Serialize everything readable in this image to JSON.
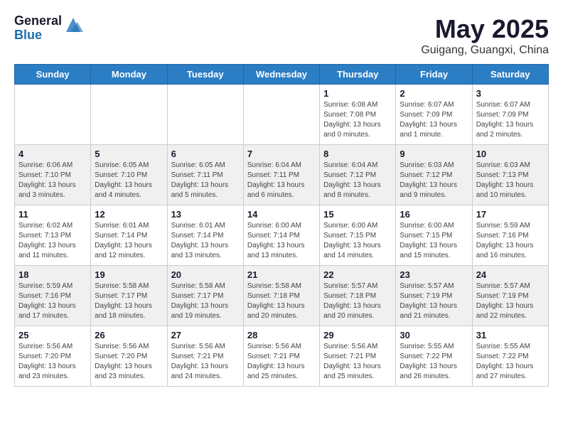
{
  "header": {
    "logo_general": "General",
    "logo_blue": "Blue",
    "title": "May 2025",
    "subtitle": "Guigang, Guangxi, China"
  },
  "days_of_week": [
    "Sunday",
    "Monday",
    "Tuesday",
    "Wednesday",
    "Thursday",
    "Friday",
    "Saturday"
  ],
  "weeks": [
    [
      {
        "day": "",
        "info": ""
      },
      {
        "day": "",
        "info": ""
      },
      {
        "day": "",
        "info": ""
      },
      {
        "day": "",
        "info": ""
      },
      {
        "day": "1",
        "info": "Sunrise: 6:08 AM\nSunset: 7:08 PM\nDaylight: 13 hours and 0 minutes."
      },
      {
        "day": "2",
        "info": "Sunrise: 6:07 AM\nSunset: 7:09 PM\nDaylight: 13 hours and 1 minute."
      },
      {
        "day": "3",
        "info": "Sunrise: 6:07 AM\nSunset: 7:09 PM\nDaylight: 13 hours and 2 minutes."
      }
    ],
    [
      {
        "day": "4",
        "info": "Sunrise: 6:06 AM\nSunset: 7:10 PM\nDaylight: 13 hours and 3 minutes."
      },
      {
        "day": "5",
        "info": "Sunrise: 6:05 AM\nSunset: 7:10 PM\nDaylight: 13 hours and 4 minutes."
      },
      {
        "day": "6",
        "info": "Sunrise: 6:05 AM\nSunset: 7:11 PM\nDaylight: 13 hours and 5 minutes."
      },
      {
        "day": "7",
        "info": "Sunrise: 6:04 AM\nSunset: 7:11 PM\nDaylight: 13 hours and 6 minutes."
      },
      {
        "day": "8",
        "info": "Sunrise: 6:04 AM\nSunset: 7:12 PM\nDaylight: 13 hours and 8 minutes."
      },
      {
        "day": "9",
        "info": "Sunrise: 6:03 AM\nSunset: 7:12 PM\nDaylight: 13 hours and 9 minutes."
      },
      {
        "day": "10",
        "info": "Sunrise: 6:03 AM\nSunset: 7:13 PM\nDaylight: 13 hours and 10 minutes."
      }
    ],
    [
      {
        "day": "11",
        "info": "Sunrise: 6:02 AM\nSunset: 7:13 PM\nDaylight: 13 hours and 11 minutes."
      },
      {
        "day": "12",
        "info": "Sunrise: 6:01 AM\nSunset: 7:14 PM\nDaylight: 13 hours and 12 minutes."
      },
      {
        "day": "13",
        "info": "Sunrise: 6:01 AM\nSunset: 7:14 PM\nDaylight: 13 hours and 13 minutes."
      },
      {
        "day": "14",
        "info": "Sunrise: 6:00 AM\nSunset: 7:14 PM\nDaylight: 13 hours and 13 minutes."
      },
      {
        "day": "15",
        "info": "Sunrise: 6:00 AM\nSunset: 7:15 PM\nDaylight: 13 hours and 14 minutes."
      },
      {
        "day": "16",
        "info": "Sunrise: 6:00 AM\nSunset: 7:15 PM\nDaylight: 13 hours and 15 minutes."
      },
      {
        "day": "17",
        "info": "Sunrise: 5:59 AM\nSunset: 7:16 PM\nDaylight: 13 hours and 16 minutes."
      }
    ],
    [
      {
        "day": "18",
        "info": "Sunrise: 5:59 AM\nSunset: 7:16 PM\nDaylight: 13 hours and 17 minutes."
      },
      {
        "day": "19",
        "info": "Sunrise: 5:58 AM\nSunset: 7:17 PM\nDaylight: 13 hours and 18 minutes."
      },
      {
        "day": "20",
        "info": "Sunrise: 5:58 AM\nSunset: 7:17 PM\nDaylight: 13 hours and 19 minutes."
      },
      {
        "day": "21",
        "info": "Sunrise: 5:58 AM\nSunset: 7:18 PM\nDaylight: 13 hours and 20 minutes."
      },
      {
        "day": "22",
        "info": "Sunrise: 5:57 AM\nSunset: 7:18 PM\nDaylight: 13 hours and 20 minutes."
      },
      {
        "day": "23",
        "info": "Sunrise: 5:57 AM\nSunset: 7:19 PM\nDaylight: 13 hours and 21 minutes."
      },
      {
        "day": "24",
        "info": "Sunrise: 5:57 AM\nSunset: 7:19 PM\nDaylight: 13 hours and 22 minutes."
      }
    ],
    [
      {
        "day": "25",
        "info": "Sunrise: 5:56 AM\nSunset: 7:20 PM\nDaylight: 13 hours and 23 minutes."
      },
      {
        "day": "26",
        "info": "Sunrise: 5:56 AM\nSunset: 7:20 PM\nDaylight: 13 hours and 23 minutes."
      },
      {
        "day": "27",
        "info": "Sunrise: 5:56 AM\nSunset: 7:21 PM\nDaylight: 13 hours and 24 minutes."
      },
      {
        "day": "28",
        "info": "Sunrise: 5:56 AM\nSunset: 7:21 PM\nDaylight: 13 hours and 25 minutes."
      },
      {
        "day": "29",
        "info": "Sunrise: 5:56 AM\nSunset: 7:21 PM\nDaylight: 13 hours and 25 minutes."
      },
      {
        "day": "30",
        "info": "Sunrise: 5:55 AM\nSunset: 7:22 PM\nDaylight: 13 hours and 26 minutes."
      },
      {
        "day": "31",
        "info": "Sunrise: 5:55 AM\nSunset: 7:22 PM\nDaylight: 13 hours and 27 minutes."
      }
    ]
  ]
}
